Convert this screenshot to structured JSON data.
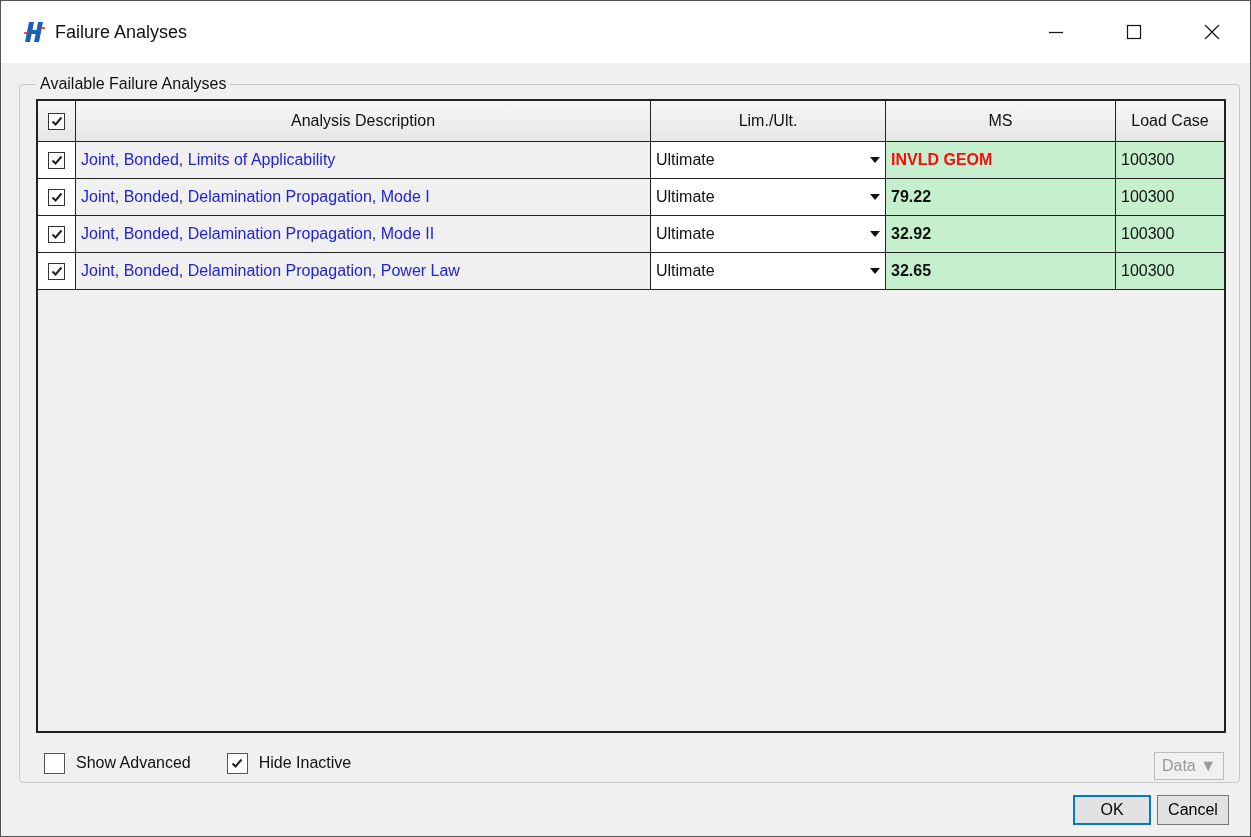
{
  "window": {
    "title": "Failure Analyses"
  },
  "group": {
    "title": "Available Failure Analyses"
  },
  "table": {
    "select_all_checked": true,
    "columns": [
      "Analysis Description",
      "Lim./Ult.",
      "MS",
      "Load Case"
    ],
    "rows": [
      {
        "checked": true,
        "description": "Joint, Bonded, Limits of Applicability",
        "limit": "Ultimate",
        "ms": "INVLD GEOM",
        "ms_invalid": true,
        "load_case": "100300"
      },
      {
        "checked": true,
        "description": "Joint, Bonded, Delamination Propagation, Mode I",
        "limit": "Ultimate",
        "ms": "79.22",
        "ms_invalid": false,
        "load_case": "100300"
      },
      {
        "checked": true,
        "description": "Joint, Bonded, Delamination Propagation, Mode II",
        "limit": "Ultimate",
        "ms": "32.92",
        "ms_invalid": false,
        "load_case": "100300"
      },
      {
        "checked": true,
        "description": "Joint, Bonded, Delamination Propagation, Power Law",
        "limit": "Ultimate",
        "ms": "32.65",
        "ms_invalid": false,
        "load_case": "100300"
      }
    ]
  },
  "options": [
    {
      "label": "Show Advanced",
      "checked": false
    },
    {
      "label": "Hide Inactive",
      "checked": true
    }
  ],
  "data_button": {
    "label": "Data ▼",
    "disabled": true
  },
  "buttons": [
    {
      "label": "OK",
      "default": true
    },
    {
      "label": "Cancel",
      "default": false
    }
  ]
}
